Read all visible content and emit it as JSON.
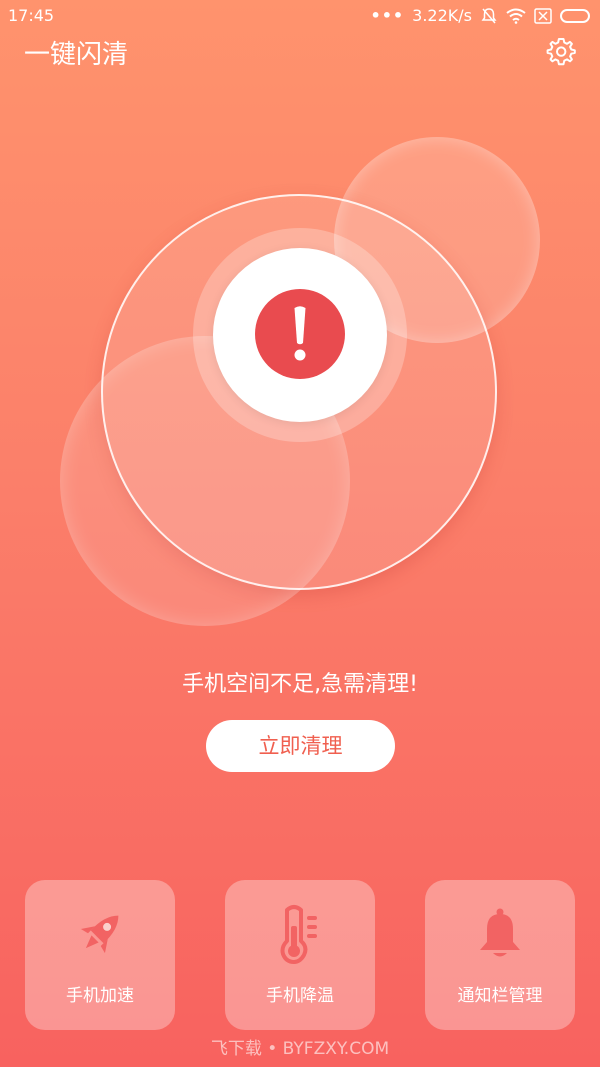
{
  "status_bar": {
    "time": "17:45",
    "dots": "•••",
    "speed": "3.22K/s"
  },
  "header": {
    "title": "一键闪清",
    "settings_icon": "gear-icon"
  },
  "main": {
    "alert_icon": "exclamation-icon",
    "message": "手机空间不足,急需清理!",
    "clean_button": "立即清理"
  },
  "tools": [
    {
      "label": "手机加速",
      "icon": "rocket-icon"
    },
    {
      "label": "手机降温",
      "icon": "thermometer-icon"
    },
    {
      "label": "通知栏管理",
      "icon": "bell-icon"
    }
  ],
  "watermark": "飞下载 • BYFZXY.COM",
  "colors": {
    "gradient_top": "#ff936d",
    "gradient_bottom": "#f8625f",
    "alert_red": "#e94b4f",
    "icon_red": "#f26363",
    "button_text": "#f05f4f"
  }
}
